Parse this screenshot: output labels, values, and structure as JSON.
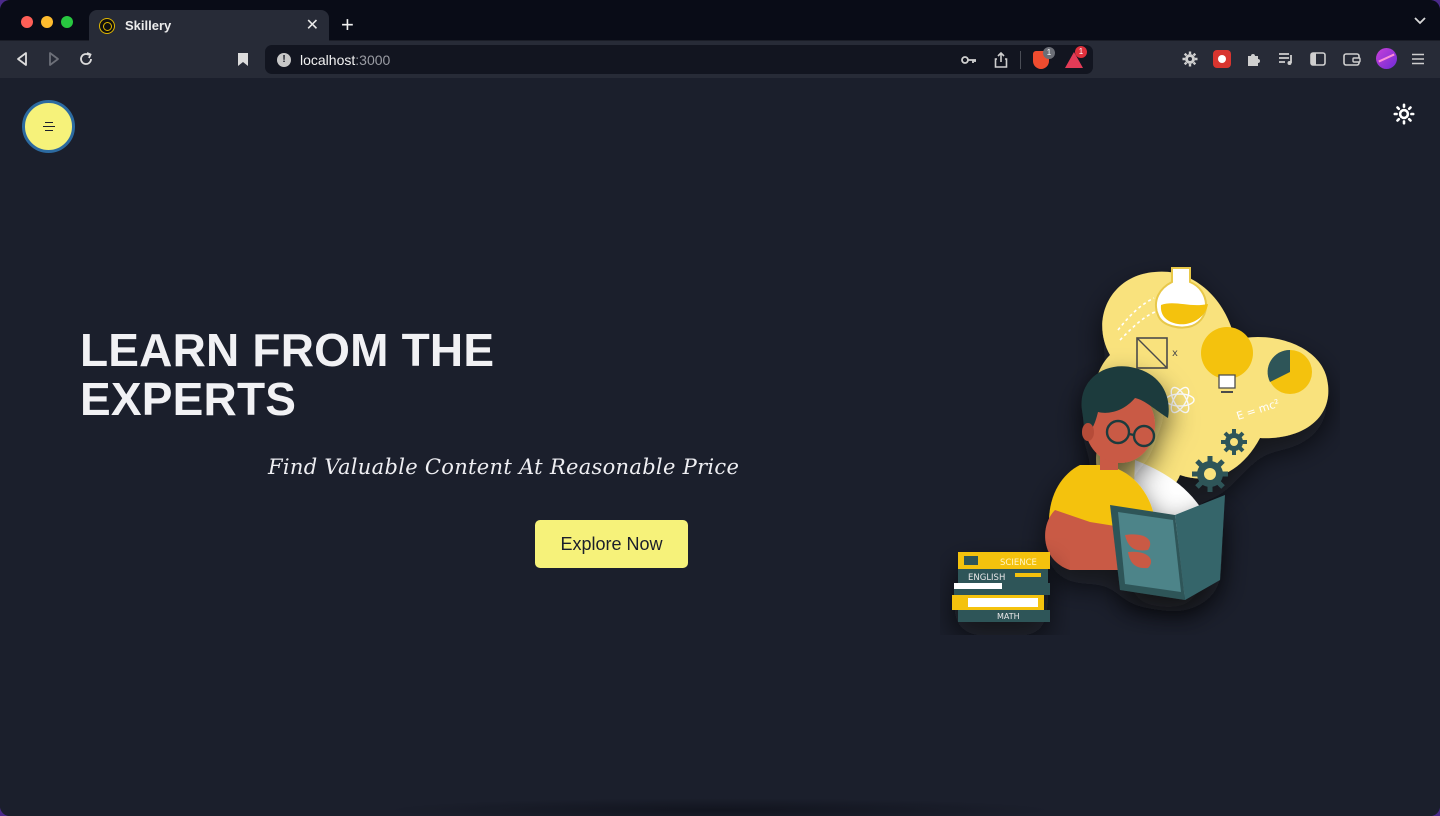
{
  "browser": {
    "tab": {
      "title": "Skillery",
      "close": "✕"
    },
    "new_tab": "+",
    "tab_menu": "⌄",
    "url": {
      "host": "localhost",
      "port": ":3000"
    },
    "badges": {
      "brave": "1",
      "rewards": "1"
    }
  },
  "page": {
    "hero": {
      "title": "LEARN FROM THE EXPERTS",
      "subtitle": "Find Valuable Content At Reasonable Price",
      "cta_label": "Explore Now"
    },
    "illustration": {
      "formula": "E = mc²",
      "books": [
        "SCIENCE",
        "ENGLISH",
        "MATH"
      ]
    }
  },
  "colors": {
    "page_bg": "#1b1f2c",
    "accent": "#f6f27a",
    "text": "#f1f1f4"
  }
}
